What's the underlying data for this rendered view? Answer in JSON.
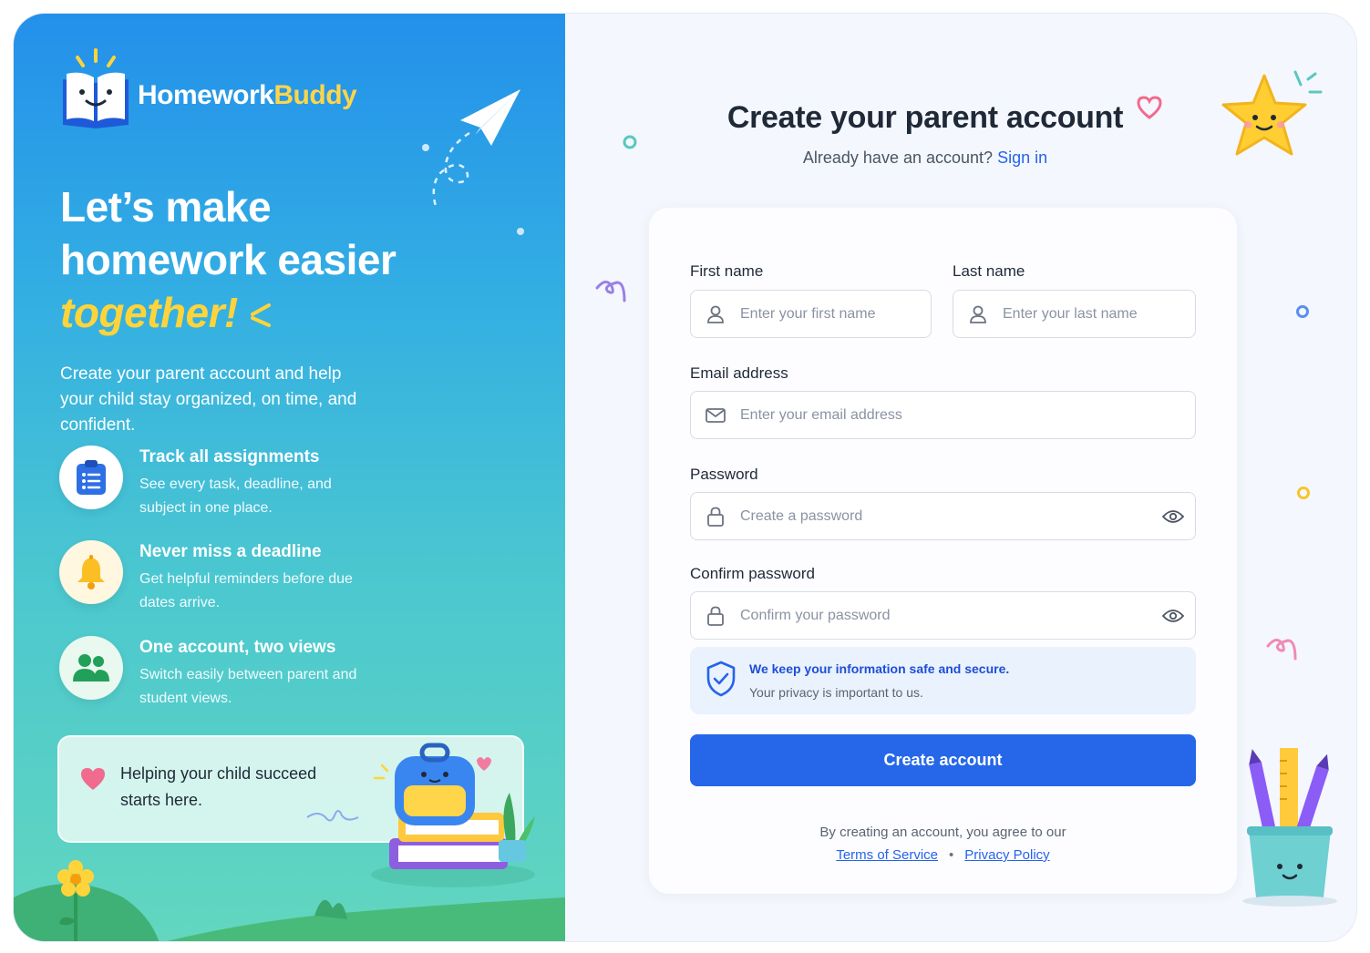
{
  "brand": {
    "name_part1": "Homework",
    "name_part2": "Buddy"
  },
  "hero": {
    "line1": "Let’s make",
    "line2": "homework easier",
    "line3": "together!",
    "lead": "Create your parent account and help your child stay organized, on time, and confident."
  },
  "features": [
    {
      "title": "Track all assignments",
      "desc": "See every task, deadline, and subject in one place.",
      "icon": "clipboard-icon"
    },
    {
      "title": "Never miss a deadline",
      "desc": "Get helpful reminders before due dates arrive.",
      "icon": "bell-icon"
    },
    {
      "title": "One account, two views",
      "desc": "Switch easily between parent and student views.",
      "icon": "users-icon"
    }
  ],
  "help_card": {
    "text": "Helping your child succeed starts here."
  },
  "form": {
    "title": "Create your parent account",
    "signin_prompt": "Already have an account?",
    "signin_link": "Sign in",
    "first_name": {
      "label": "First name",
      "placeholder": "Enter your first name"
    },
    "last_name": {
      "label": "Last name",
      "placeholder": "Enter your last name"
    },
    "email": {
      "label": "Email address",
      "placeholder": "Enter your email address"
    },
    "password": {
      "label": "Password",
      "placeholder": "Create a password"
    },
    "confirm": {
      "label": "Confirm password",
      "placeholder": "Confirm your password"
    },
    "secure_title": "We keep your information safe and secure.",
    "secure_sub": "Your privacy is important to us.",
    "submit": "Create account",
    "terms_prefix": "By creating an account, you agree to our",
    "terms_link": "Terms of Service",
    "privacy_link": "Privacy Policy"
  },
  "colors": {
    "accent": "#2567e8",
    "brand_yellow": "#ffd54a",
    "panel_top": "#2390ea",
    "panel_bottom": "#62d6bf"
  }
}
